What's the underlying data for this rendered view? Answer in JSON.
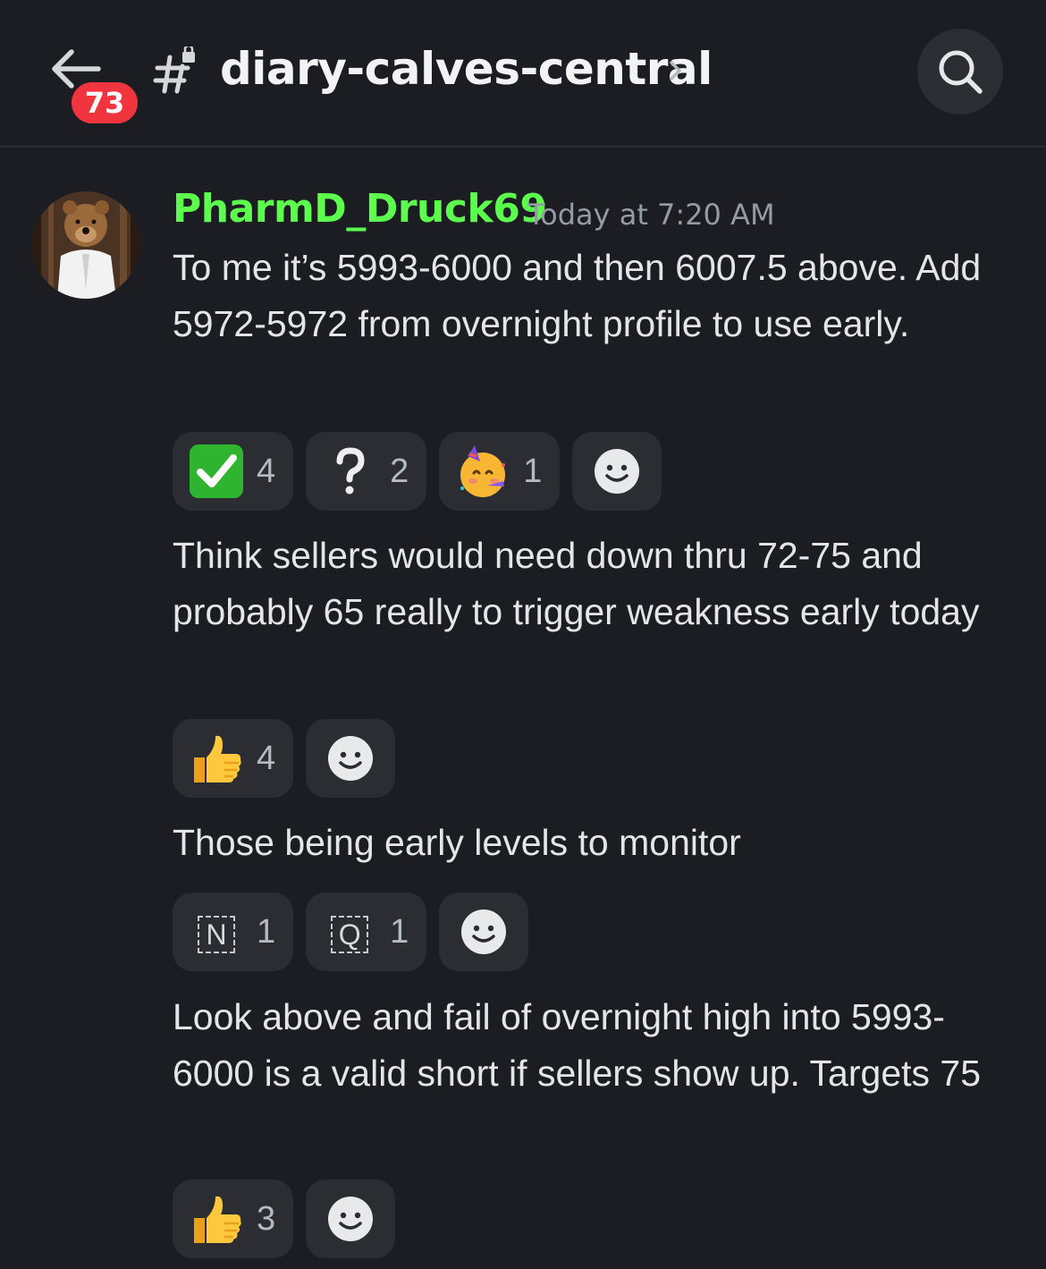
{
  "header": {
    "unread_count": "73",
    "channel_name": "diary-calves-central"
  },
  "message": {
    "author": "PharmD_Druck69",
    "author_color": "#5dff4f",
    "timestamp": "Today at 7:20 AM",
    "lines": [
      {
        "text": "To me it’s 5993-6000 and then 6007.5 above. Add 5972-5972 from overnight profile to use early.",
        "reactions": [
          {
            "icon": "check-mark-icon",
            "count": "4"
          },
          {
            "icon": "question-mark-icon",
            "count": "2"
          },
          {
            "icon": "partying-face-icon",
            "count": "1"
          }
        ]
      },
      {
        "text": "Think sellers would need down thru 72-75 and probably 65 really to trigger weakness early today",
        "reactions": [
          {
            "icon": "thumbs-up-icon",
            "count": "4"
          }
        ]
      },
      {
        "text": "Those being early levels to monitor",
        "reactions": [
          {
            "icon": "letter-n-icon",
            "letter": "N",
            "count": "1"
          },
          {
            "icon": "letter-q-icon",
            "letter": "Q",
            "count": "1"
          }
        ]
      },
      {
        "text": "Look above and fail of overnight high into 5993-6000 is a valid short if sellers show up. Targets 75",
        "reactions": [
          {
            "icon": "thumbs-up-icon",
            "count": "3"
          }
        ]
      }
    ]
  },
  "colors": {
    "background": "#1c1d22",
    "reaction_bg": "#2b2d33",
    "badge": "#f0353f",
    "timestamp": "#949ba4"
  }
}
